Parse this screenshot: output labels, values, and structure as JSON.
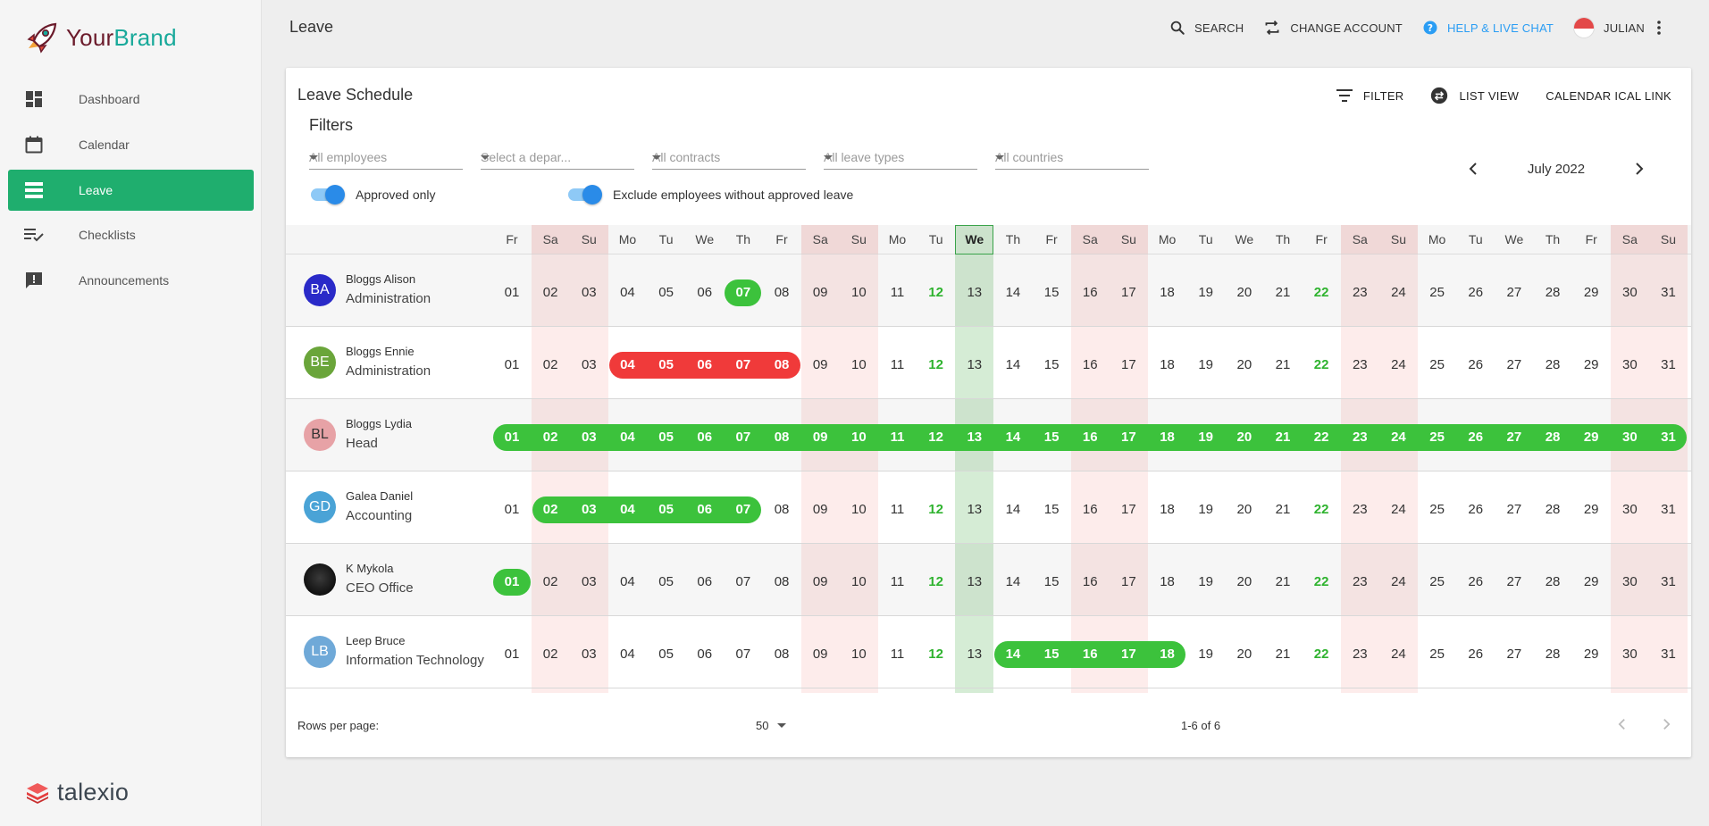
{
  "brand": {
    "your": "Your",
    "brand": "Brand"
  },
  "sidebar": {
    "items": [
      {
        "label": "Dashboard",
        "icon": "dashboard-icon",
        "active": false
      },
      {
        "label": "Calendar",
        "icon": "calendar-icon",
        "active": false
      },
      {
        "label": "Leave",
        "icon": "leave-icon",
        "active": true
      },
      {
        "label": "Checklists",
        "icon": "checklist-icon",
        "active": false
      },
      {
        "label": "Announcements",
        "icon": "announcement-icon",
        "active": false
      }
    ],
    "footer_logo": "talexio"
  },
  "header": {
    "title": "Leave",
    "search": "SEARCH",
    "change_account": "CHANGE ACCOUNT",
    "help": "HELP & LIVE CHAT",
    "user": "JULIAN"
  },
  "card": {
    "title": "Leave Schedule",
    "filter_button": "FILTER",
    "list_view_button": "LIST VIEW",
    "ical_button": "CALENDAR ICAL LINK",
    "filters_title": "Filters",
    "selects": [
      {
        "name": "employees-select",
        "placeholder": "All employees"
      },
      {
        "name": "department-select",
        "placeholder": "Select a depar..."
      },
      {
        "name": "contracts-select",
        "placeholder": "All contracts"
      },
      {
        "name": "leave-types-select",
        "placeholder": "All leave types"
      },
      {
        "name": "countries-select",
        "placeholder": "All countries"
      }
    ],
    "toggles": [
      {
        "name": "approved-only-toggle",
        "label": "Approved only",
        "on": true
      },
      {
        "name": "exclude-without-leave-toggle",
        "label": "Exclude employees without approved leave",
        "on": true
      }
    ],
    "month": "July 2022"
  },
  "schedule": {
    "weekday_labels": [
      "Fr",
      "Sa",
      "Su",
      "Mo",
      "Tu",
      "We",
      "Th",
      "Fr",
      "Sa",
      "Su",
      "Mo",
      "Tu",
      "We",
      "Th",
      "Fr",
      "Sa",
      "Su",
      "Mo",
      "Tu",
      "We",
      "Th",
      "Fr",
      "Sa",
      "Su",
      "Mo",
      "Tu",
      "We",
      "Th",
      "Fr",
      "Sa",
      "Su"
    ],
    "days": [
      "01",
      "02",
      "03",
      "04",
      "05",
      "06",
      "07",
      "08",
      "09",
      "10",
      "11",
      "12",
      "13",
      "14",
      "15",
      "16",
      "17",
      "18",
      "19",
      "20",
      "21",
      "22",
      "23",
      "24",
      "25",
      "26",
      "27",
      "28",
      "29",
      "30",
      "31"
    ],
    "weekend_days": [
      2,
      3,
      9,
      10,
      16,
      17,
      23,
      24,
      30,
      31
    ],
    "today": 13,
    "public_holidays": [
      12,
      22
    ],
    "employees": [
      {
        "initials": "BA",
        "name": "Bloggs Alison",
        "department": "Administration",
        "avatar_color": "#2a2ac8",
        "leaves": [
          {
            "start": 7,
            "end": 7,
            "status": "approved"
          }
        ]
      },
      {
        "initials": "BE",
        "name": "Bloggs Ennie",
        "department": "Administration",
        "avatar_color": "#6aa53a",
        "leaves": [
          {
            "start": 4,
            "end": 8,
            "status": "rejected"
          }
        ]
      },
      {
        "initials": "BL",
        "name": "Bloggs Lydia",
        "department": "Head",
        "avatar_color": "#e7a2a6",
        "avatar_text_color": "#333",
        "leaves": [
          {
            "start": 1,
            "end": 31,
            "status": "approved"
          }
        ]
      },
      {
        "initials": "GD",
        "name": "Galea Daniel",
        "department": "Accounting",
        "avatar_color": "#4aa3d6",
        "leaves": [
          {
            "start": 2,
            "end": 7,
            "status": "approved"
          }
        ]
      },
      {
        "initials": "",
        "name": "K Mykola",
        "department": "CEO Office",
        "avatar_color": "#1e1e1e",
        "leaves": [
          {
            "start": 1,
            "end": 1,
            "status": "approved"
          }
        ]
      },
      {
        "initials": "LB",
        "name": "Leep Bruce",
        "department": "Information Technology",
        "avatar_color": "#6fa9d8",
        "leaves": [
          {
            "start": 14,
            "end": 18,
            "status": "approved"
          }
        ]
      }
    ]
  },
  "footer": {
    "rows_per_page_label": "Rows per page:",
    "rows_per_page_value": "50",
    "pagination_text": "1-6 of 6"
  },
  "colors": {
    "accent": "#1fae6e",
    "approved": "#3cc23c",
    "rejected": "#f03a3a",
    "weekend_bg": "#fdeceb",
    "today_bg": "#d5ecd5",
    "help": "#2a9df4"
  }
}
